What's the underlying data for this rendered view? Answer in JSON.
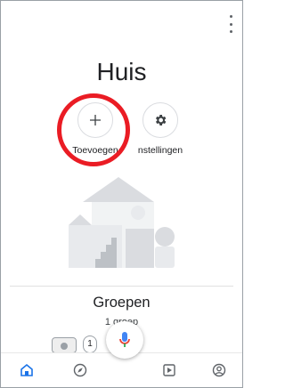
{
  "header": {
    "title": "Huis",
    "menu_icon": "more-vert-icon"
  },
  "actions": {
    "add_label": "Toevoegen",
    "add_icon": "plus-icon",
    "settings_label": "nstellingen",
    "settings_icon": "gear-icon"
  },
  "groups": {
    "title": "Groepen",
    "count": "1 groep",
    "chip_count": "1"
  },
  "bottom_nav": [
    "home-icon",
    "compass-icon",
    "media-icon",
    "account-icon"
  ],
  "colors": {
    "accent": "#1a73e8",
    "highlight": "#ea1c24",
    "mic_blue": "#4285f4",
    "mic_red": "#ea4335"
  }
}
